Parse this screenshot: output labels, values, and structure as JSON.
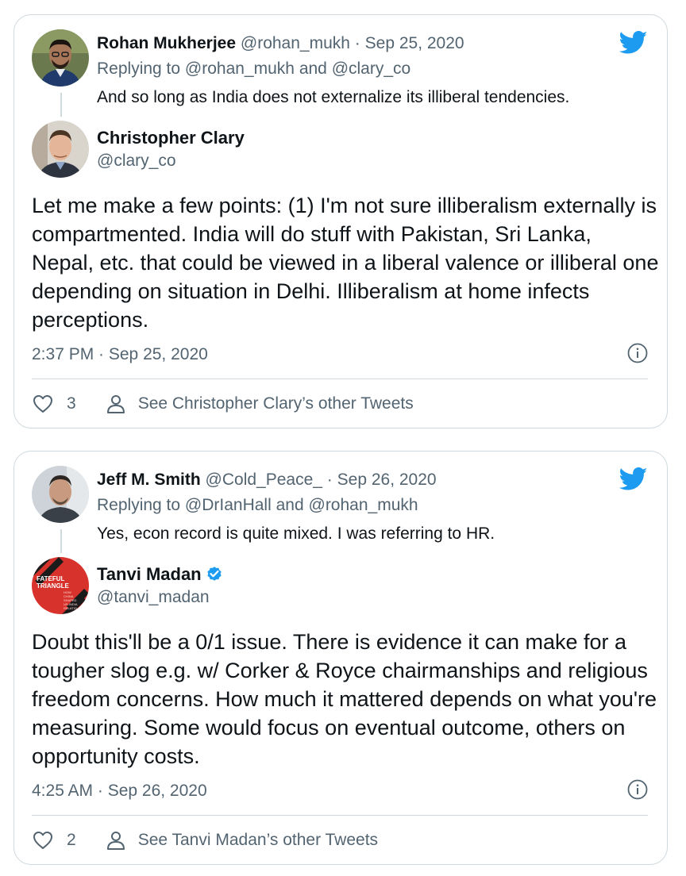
{
  "tweets": [
    {
      "parent": {
        "name": "Rohan Mukherjee",
        "handle": "@rohan_mukh",
        "separator": "·",
        "date": "Sep 25, 2020",
        "replying_prefix": "Replying to",
        "reply_to_1": "@rohan_mukh",
        "reply_and": "and",
        "reply_to_2": "@clary_co",
        "text": "And so long as India does not externalize its illiberal tendencies."
      },
      "author": {
        "name": "Christopher Clary",
        "handle": "@clary_co",
        "verified": false
      },
      "text": "Let me make a few points: (1) I'm not sure illiberalism externally is compartmented. India will do stuff with Pakistan, Sri Lanka, Nepal, etc. that could be viewed in a liberal valence or illiberal one depending on situation in Delhi. Illiberalism at home infects perceptions.",
      "timestamp": "2:37 PM · Sep 25, 2020",
      "likes": "3",
      "other_tweets_label": "See Christopher Clary’s other Tweets"
    },
    {
      "parent": {
        "name": "Jeff M. Smith",
        "handle": "@Cold_Peace_",
        "separator": "·",
        "date": "Sep 26, 2020",
        "replying_prefix": "Replying to",
        "reply_to_1": "@DrIanHall",
        "reply_and": "and",
        "reply_to_2": "@rohan_mukh",
        "text": "Yes, econ record is quite mixed. I was referring to HR."
      },
      "author": {
        "name": "Tanvi Madan",
        "handle": "@tanvi_madan",
        "verified": true
      },
      "avatar_text": {
        "line1": "FATEFUL",
        "line2": "TRIANGLE",
        "small1": "HOW",
        "small2": "CHINA",
        "small3": "SHAPED",
        "small4": "US-INDIA",
        "small5": "RELATIO"
      },
      "text": "Doubt this'll be a 0/1 issue. There is evidence it can make for a tougher slog e.g. w/ Corker & Royce chairmanships and religious freedom concerns. How much it mattered depends on what you're measuring. Some would focus on eventual outcome, others on opportunity costs.",
      "timestamp": "4:25 AM · Sep 26, 2020",
      "likes": "2",
      "other_tweets_label": "See Tanvi Madan’s other Tweets"
    }
  ],
  "colors": {
    "twitter_blue": "#1d9bf0",
    "muted_text": "#536471",
    "border": "#cfd9de"
  },
  "icons": [
    "twitter-bird-icon",
    "verified-badge-icon",
    "info-icon",
    "heart-icon",
    "person-icon"
  ]
}
